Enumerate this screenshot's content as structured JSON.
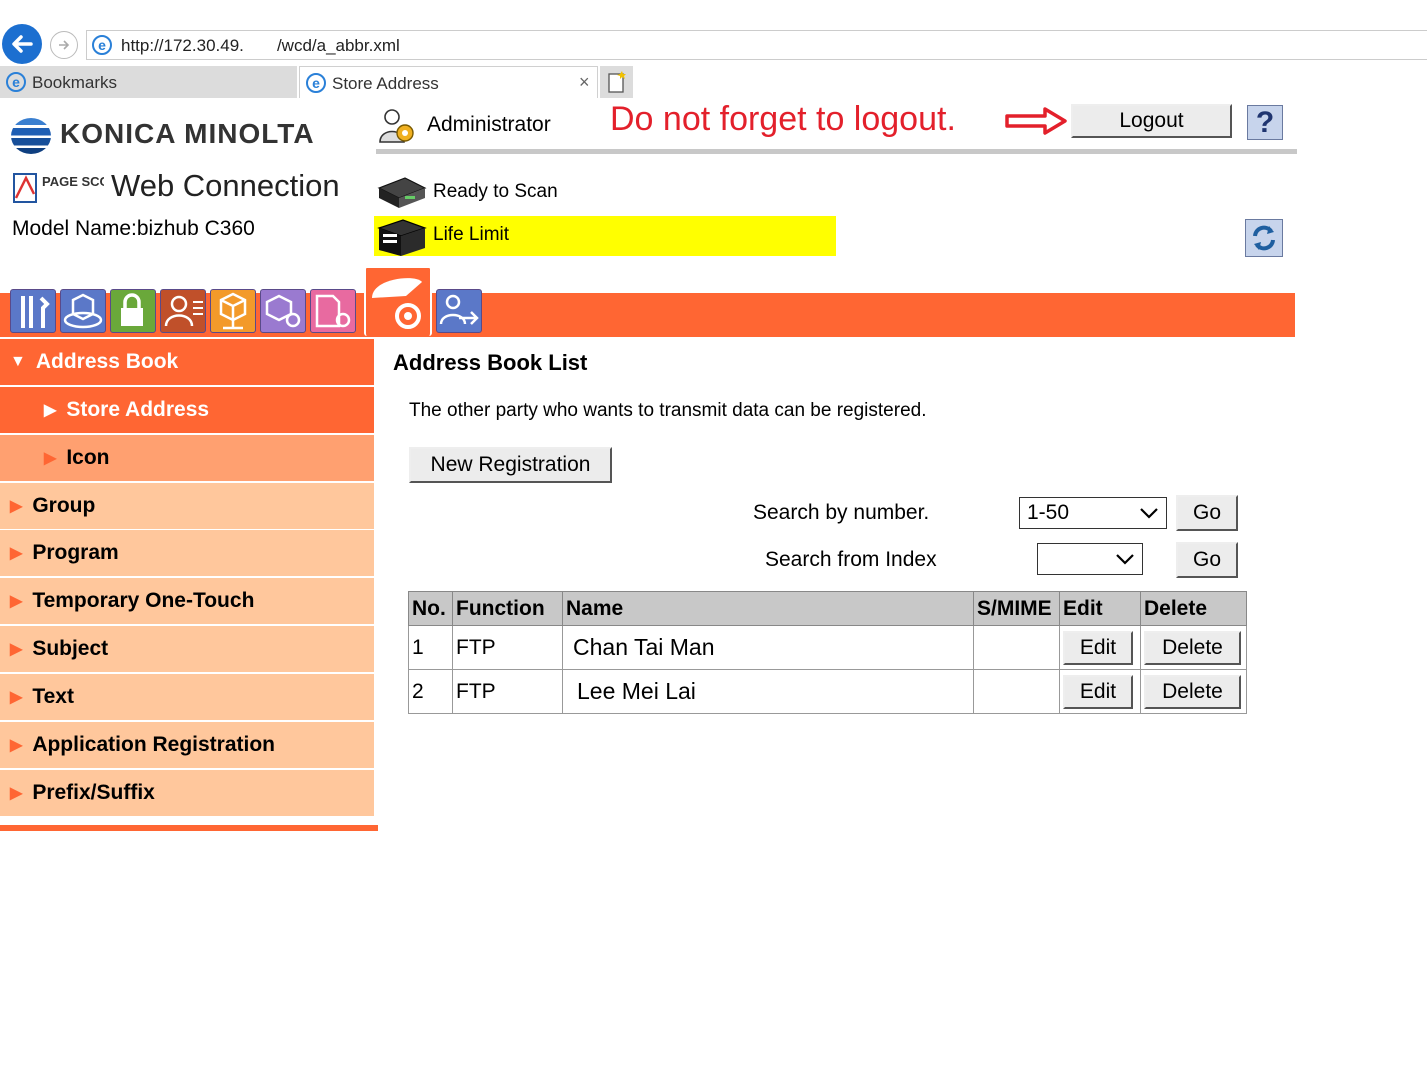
{
  "browser": {
    "url": "http://172.30.49.       /wcd/a_abbr.xml",
    "tabs": [
      {
        "label": "Bookmarks"
      },
      {
        "label": "Store Address",
        "close": "×"
      }
    ]
  },
  "header": {
    "brand": "KONICA MINOLTA",
    "product_small": "PAGE SCOPE",
    "product": "Web Connection",
    "model": "Model Name:bizhub C360",
    "user_role": "Administrator",
    "reminder": "Do not forget to logout.",
    "logout_label": "Logout",
    "help_label": "?",
    "reminder_color": "#e3202b"
  },
  "status": [
    {
      "text": "Ready to Scan",
      "highlight": false
    },
    {
      "text": "Life Limit",
      "highlight": true,
      "highlight_color": "#ffff00"
    }
  ],
  "mode_tabs": [
    {
      "icon": "maintenance-icon"
    },
    {
      "icon": "system-settings-icon"
    },
    {
      "icon": "security-icon"
    },
    {
      "icon": "user-auth-icon"
    },
    {
      "icon": "network-icon"
    },
    {
      "icon": "box-icon"
    },
    {
      "icon": "print-settings-icon"
    },
    {
      "icon": "store-address-icon",
      "selected": true
    },
    {
      "icon": "fax-settings-icon"
    }
  ],
  "accent_color": "#ff6633",
  "sidebar": {
    "items": [
      {
        "label": "Address Book",
        "level": 0,
        "state": "open"
      },
      {
        "label": "Store Address",
        "level": 1,
        "state": "selected"
      },
      {
        "label": "Icon",
        "level": 1,
        "state": "sub"
      },
      {
        "label": "Group",
        "level": 0,
        "state": "closed"
      },
      {
        "label": "Program",
        "level": 0,
        "state": "closed"
      },
      {
        "label": "Temporary One-Touch",
        "level": 0,
        "state": "closed"
      },
      {
        "label": "Subject",
        "level": 0,
        "state": "closed"
      },
      {
        "label": "Text",
        "level": 0,
        "state": "closed"
      },
      {
        "label": "Application Registration",
        "level": 0,
        "state": "closed"
      },
      {
        "label": "Prefix/Suffix",
        "level": 0,
        "state": "closed"
      }
    ]
  },
  "main": {
    "title": "Address Book List",
    "description": "The other party who wants to transmit data can be registered.",
    "new_registration_label": "New Registration",
    "search_number": {
      "label": "Search by number.",
      "selected": "1-50",
      "go_label": "Go"
    },
    "search_index": {
      "label": "Search from Index",
      "selected": "",
      "go_label": "Go"
    },
    "table": {
      "columns": [
        "No.",
        "Function",
        "Name",
        "S/MIME",
        "Edit",
        "Delete"
      ],
      "rows": [
        {
          "no": "1",
          "function": "FTP",
          "name": "Chan Tai Man",
          "smime": "",
          "edit": "Edit",
          "delete": "Delete"
        },
        {
          "no": "2",
          "function": "FTP",
          "name": "Lee Mei Lai",
          "smime": "",
          "edit": "Edit",
          "delete": "Delete"
        }
      ]
    }
  }
}
